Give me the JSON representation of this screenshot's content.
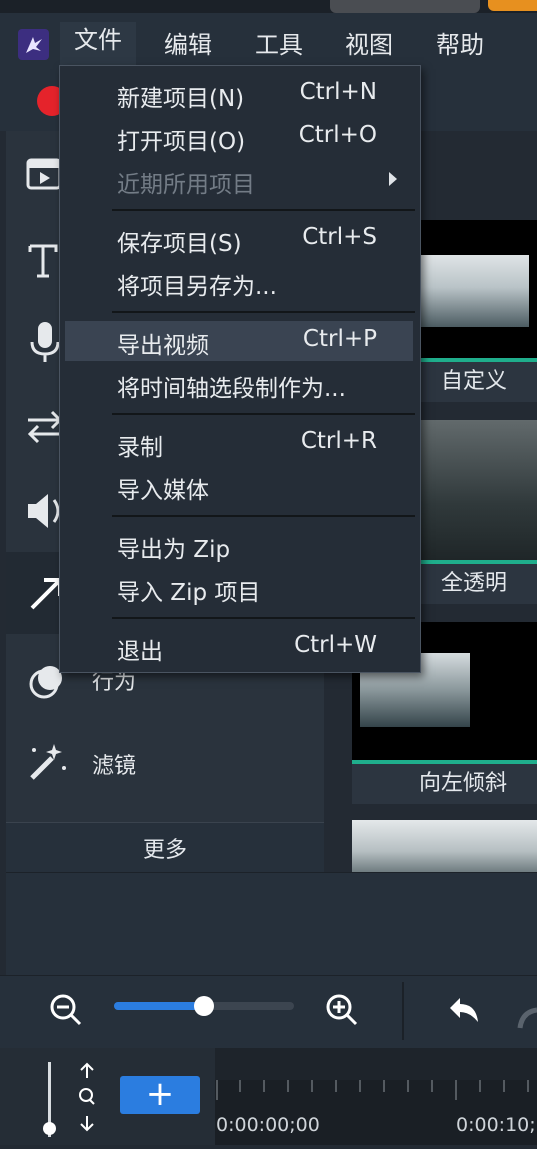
{
  "menubar": {
    "items": [
      {
        "label": "文件"
      },
      {
        "label": "编辑"
      },
      {
        "label": "工具"
      },
      {
        "label": "视图"
      },
      {
        "label": "帮助"
      }
    ]
  },
  "sidebar": {
    "items": [
      {
        "icon": "media-icon",
        "label": ""
      },
      {
        "icon": "text-icon",
        "label": ""
      },
      {
        "icon": "microphone-icon",
        "label": ""
      },
      {
        "icon": "transition-icon",
        "label": ""
      },
      {
        "icon": "audio-icon",
        "label": ""
      },
      {
        "icon": "arrow-icon",
        "label": ""
      },
      {
        "icon": "behavior-icon",
        "label": "行为"
      },
      {
        "icon": "magic-wand-icon",
        "label": "滤镜"
      }
    ],
    "more_label": "更多"
  },
  "presets": [
    {
      "label": "自定义"
    },
    {
      "label": "全透明"
    },
    {
      "label": "向左倾斜"
    }
  ],
  "file_menu": {
    "items": [
      {
        "label": "新建项目(N)",
        "shortcut": "Ctrl+N"
      },
      {
        "label": "打开项目(O)",
        "shortcut": "Ctrl+O"
      },
      {
        "label": "近期所用项目",
        "shortcut": "",
        "disabled": true,
        "submenu": true
      },
      {
        "label": "保存项目(S)",
        "shortcut": "Ctrl+S"
      },
      {
        "label": "将项目另存为...",
        "shortcut": ""
      },
      {
        "label": "导出视频",
        "shortcut": "Ctrl+P",
        "highlighted": true
      },
      {
        "label": "将时间轴选段制作为...",
        "shortcut": ""
      },
      {
        "label": "录制",
        "shortcut": "Ctrl+R"
      },
      {
        "label": "导入媒体",
        "shortcut": ""
      },
      {
        "label": "导出为 Zip",
        "shortcut": ""
      },
      {
        "label": "导入 Zip 项目",
        "shortcut": ""
      },
      {
        "label": "退出",
        "shortcut": "Ctrl+W"
      }
    ]
  },
  "zoom": {
    "level": 0.5
  },
  "timeline": {
    "add_label": "+",
    "timecodes": [
      "0:00:00;00",
      "0:00:10;"
    ]
  },
  "colors": {
    "accent": "#2b7de0",
    "record": "#e5232b",
    "preset_strip": "#1fae8c"
  }
}
